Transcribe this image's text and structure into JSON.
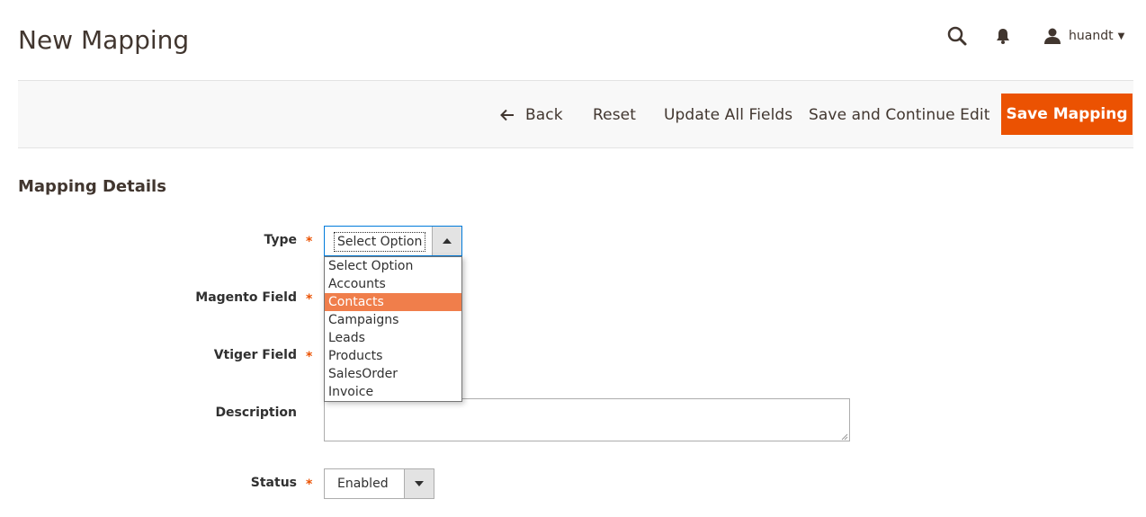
{
  "header": {
    "title": "New Mapping",
    "user_name": "huandt"
  },
  "actions": {
    "back_label": "Back",
    "reset_label": "Reset",
    "update_label": "Update All Fields",
    "save_continue_label": "Save and Continue Edit",
    "save_label": "Save Mapping"
  },
  "section": {
    "title": "Mapping Details"
  },
  "fields": {
    "type": {
      "label": "Type",
      "required": "*",
      "value": "Select Option",
      "options": [
        "Select Option",
        "Accounts",
        "Contacts",
        "Campaigns",
        "Leads",
        "Products",
        "SalesOrder",
        "Invoice"
      ],
      "highlighted": "Contacts"
    },
    "magento_field": {
      "label": "Magento Field",
      "required": "*"
    },
    "vtiger_field": {
      "label": "Vtiger Field",
      "required": "*"
    },
    "description": {
      "label": "Description",
      "value": ""
    },
    "status": {
      "label": "Status",
      "required": "*",
      "value": "Enabled"
    }
  },
  "colors": {
    "accent": "#eb5202",
    "highlight": "#f07e4b",
    "focus_border": "#007bdb"
  },
  "icons": [
    "search-icon",
    "bell-icon",
    "user-icon",
    "caret-down-icon",
    "arrow-left-icon",
    "caret-up-icon"
  ]
}
